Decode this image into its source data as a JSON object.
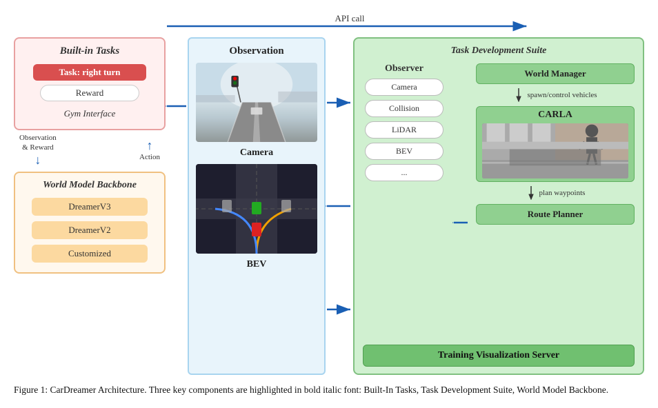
{
  "diagram": {
    "api_call_label": "API call",
    "left": {
      "built_in_tasks_title": "Built-in Tasks",
      "task_label": "Task: right turn",
      "reward_label": "Reward",
      "gym_interface_label": "Gym Interface",
      "obs_reward_label": "Observation\n& Reward",
      "action_label": "Action",
      "world_model_title": "World Model Backbone",
      "dreamer_v3": "DreamerV3",
      "dreamer_v2": "DreamerV2",
      "customized": "Customized"
    },
    "center": {
      "observation_title": "Observation",
      "camera_title": "Camera",
      "bev_label": "BEV"
    },
    "right": {
      "task_dev_title": "Task Development Suite",
      "observer_title": "Observer",
      "camera_pill": "Camera",
      "collision_pill": "Collision",
      "lidar_pill": "LiDAR",
      "bev_pill": "BEV",
      "dots_pill": "...",
      "world_manager_title": "World Manager",
      "spawn_label": "spawn/control vehicles",
      "carla_title": "CARLA",
      "plan_label": "plan waypoints",
      "route_planner_title": "Route Planner",
      "training_vis_title": "Training Visualization Server"
    }
  },
  "caption": {
    "text": "Figure 1: CarDreamer Architecture. Three key components are highlighted in bold italic font: Built-In Tasks, Task Development Suite, World Model Backbone."
  }
}
